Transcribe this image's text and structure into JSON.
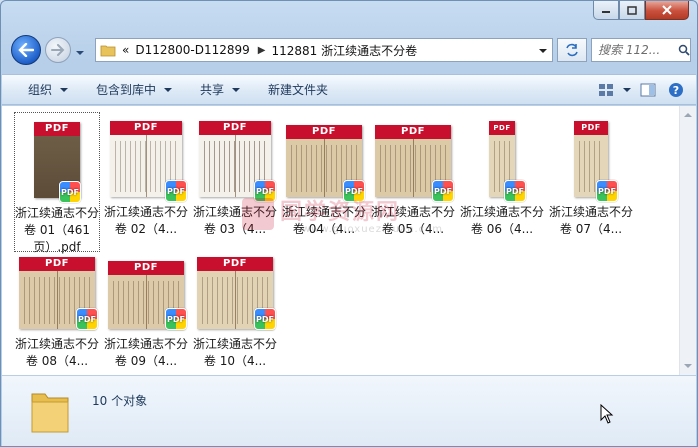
{
  "nav": {
    "address_overflow": "«",
    "breadcrumbs": [
      "D112800-D112899",
      "112881 浙江续通志不分卷"
    ],
    "search_placeholder": "搜索 112..."
  },
  "toolbar": {
    "items": [
      "组织",
      "包含到库中",
      "共享",
      "新建文件夹"
    ]
  },
  "files": [
    {
      "label": "浙江续通志不分卷 01（461页）.pdf",
      "selected": true
    },
    {
      "label": "浙江续通志不分卷 02（4..."
    },
    {
      "label": "浙江续通志不分卷 03（4..."
    },
    {
      "label": "浙江续通志不分卷 04（4..."
    },
    {
      "label": "浙江续通志不分卷 05（4..."
    },
    {
      "label": "浙江续通志不分卷 06（4..."
    },
    {
      "label": "浙江续通志不分卷 07（4..."
    },
    {
      "label": "浙江续通志不分卷 08（4..."
    },
    {
      "label": "浙江续通志不分卷 09（4..."
    },
    {
      "label": "浙江续通志不分卷 10（4..."
    }
  ],
  "thumb_band_text": "PDF",
  "badge_text": "PDF",
  "watermark": {
    "text": "国学资源网",
    "url": "www.guoxueziyuan.com"
  },
  "status": {
    "count_text": "10 个对象"
  },
  "colors": {
    "pdf_band": "#c8102e",
    "page_paper": "#d9c8a8",
    "link_text": "#1e395b"
  }
}
